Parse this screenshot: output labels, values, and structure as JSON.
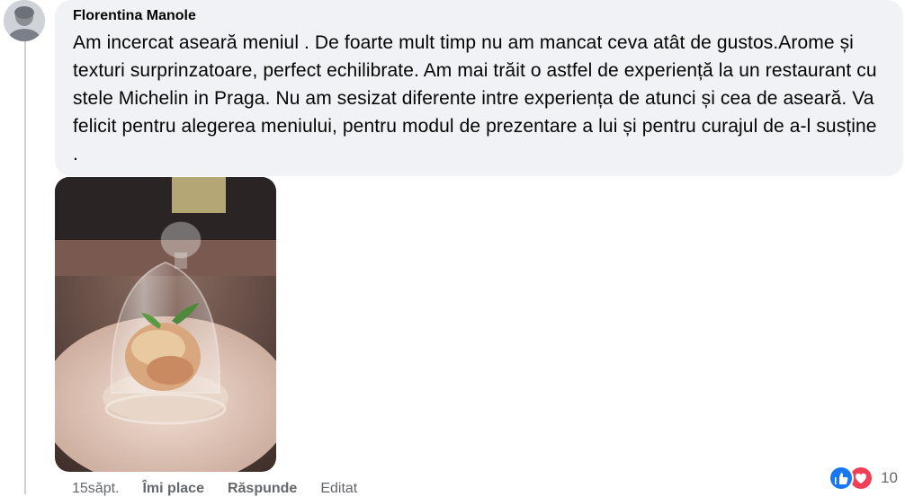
{
  "comment": {
    "author": "Florentina Manole",
    "text": "Am incercat aseară meniul . De foarte mult timp nu am mancat ceva atât de gustos.Arome și texturi surprinzatoare, perfect echilibrate. Am mai trăit o astfel de experiență la un restaurant cu stele Michelin in Praga. Nu am sesizat diferente intre experiența de atunci și cea de aseară. Va felicit pentru alegerea meniului, pentru modul de prezentare a lui și pentru curajul de a-l susține ."
  },
  "actions": {
    "time": "15săpt.",
    "like_label": "Îmi place",
    "reply_label": "Răspunde",
    "edited_label": "Editat"
  },
  "reactions": {
    "icons": [
      "like-icon",
      "love-icon"
    ],
    "count": "10",
    "colors": {
      "like": "#1877f2",
      "love": "#f33e58"
    }
  }
}
